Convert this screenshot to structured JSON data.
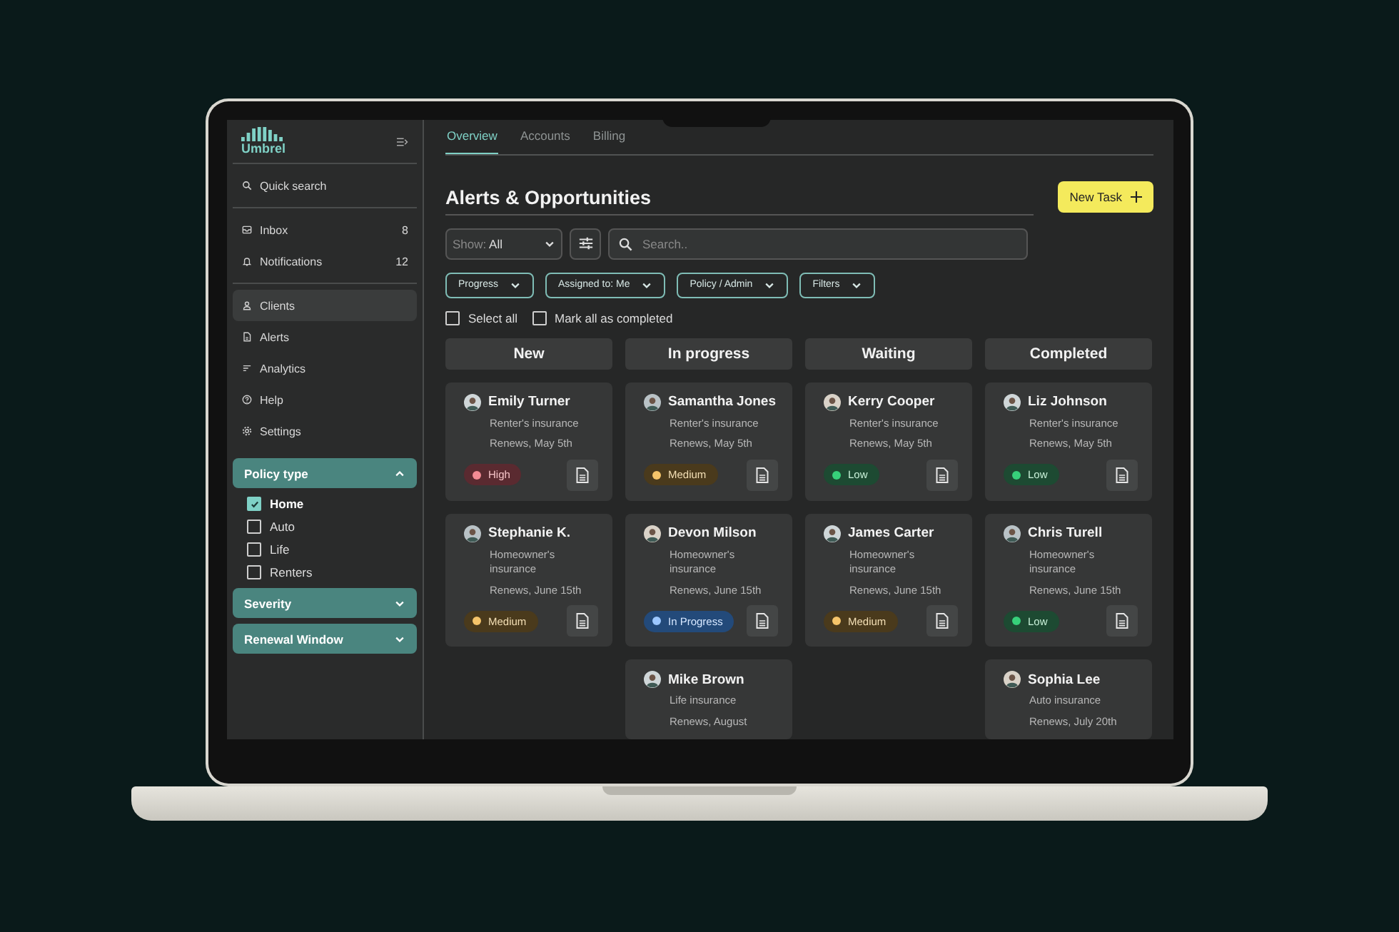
{
  "sidebar": {
    "logo": "Umbrel",
    "search": "Quick search",
    "items": [
      {
        "label": "Inbox",
        "kind": "inbox",
        "count": "8",
        "selected": false
      },
      {
        "label": "Notifications",
        "kind": "bell",
        "count": "12",
        "selected": false
      },
      {
        "label": "Clients",
        "kind": "user",
        "selected": true
      },
      {
        "label": "Alerts",
        "kind": "doc",
        "selected": false
      },
      {
        "label": "Analytics",
        "kind": "lines",
        "selected": false
      },
      {
        "label": "Help",
        "kind": "help",
        "selected": false
      },
      {
        "label": "Settings",
        "kind": "gear",
        "selected": false
      }
    ],
    "filters": [
      {
        "title": "Policy type",
        "expanded": true,
        "options": [
          {
            "label": "Home",
            "checked": true
          },
          {
            "label": "Auto",
            "checked": false
          },
          {
            "label": "Life",
            "checked": false
          },
          {
            "label": "Renters",
            "checked": false
          }
        ]
      },
      {
        "title": "Severity",
        "expanded": false
      },
      {
        "title": "Renewal Window",
        "expanded": false
      }
    ]
  },
  "tabs": [
    {
      "label": "Overview",
      "selected": true
    },
    {
      "label": "Accounts",
      "selected": false
    },
    {
      "label": "Billing",
      "selected": false
    }
  ],
  "title": "Alerts & Opportunities",
  "new_task": "New Task",
  "show": {
    "label": "Show:",
    "value": "All"
  },
  "search": {
    "placeholder": "Search.."
  },
  "chips": [
    "Progress",
    "Assigned to: Me",
    "Policy / Admin",
    "Filters"
  ],
  "bulk": [
    {
      "label": "Select all",
      "checked": false
    },
    {
      "label": "Mark all as completed",
      "checked": false
    }
  ],
  "columns": [
    {
      "title": "New",
      "cards": [
        {
          "name": "Emily Turner",
          "policy": "Renter's insurance",
          "renews": "Renews, May 5th",
          "status": {
            "label": "High",
            "kind": "high"
          }
        },
        {
          "name": "Stephanie K.",
          "policy": "Homeowner's insurance",
          "renews": "Renews, June 15th",
          "status": {
            "label": "Medium",
            "kind": "medium"
          }
        }
      ]
    },
    {
      "title": "In progress",
      "cards": [
        {
          "name": "Samantha Jones",
          "policy": "Renter's insurance",
          "renews": "Renews, May 5th",
          "status": {
            "label": "Medium",
            "kind": "medium"
          }
        },
        {
          "name": "Devon Milson",
          "policy": "Homeowner's insurance",
          "renews": "Renews, June 15th",
          "status": {
            "label": "In Progress",
            "kind": "progress"
          }
        },
        {
          "name": "Mike Brown",
          "policy": "Life insurance",
          "renews": "Renews, August"
        }
      ]
    },
    {
      "title": "Waiting",
      "cards": [
        {
          "name": "Kerry Cooper",
          "policy": "Renter's insurance",
          "renews": "Renews, May 5th",
          "status": {
            "label": "Low",
            "kind": "low"
          }
        },
        {
          "name": "James Carter",
          "policy": "Homeowner's insurance",
          "renews": "Renews, June 15th",
          "status": {
            "label": "Medium",
            "kind": "medium"
          }
        }
      ]
    },
    {
      "title": "Completed",
      "cards": [
        {
          "name": "Liz Johnson",
          "policy": "Renter's insurance",
          "renews": "Renews, May 5th",
          "status": {
            "label": "Low",
            "kind": "low"
          }
        },
        {
          "name": "Chris Turell",
          "policy": "Homeowner's insurance",
          "renews": "Renews, June 15th",
          "status": {
            "label": "Low",
            "kind": "low"
          }
        },
        {
          "name": "Sophia Lee",
          "policy": "Auto insurance",
          "renews": "Renews, July 20th"
        }
      ]
    }
  ]
}
